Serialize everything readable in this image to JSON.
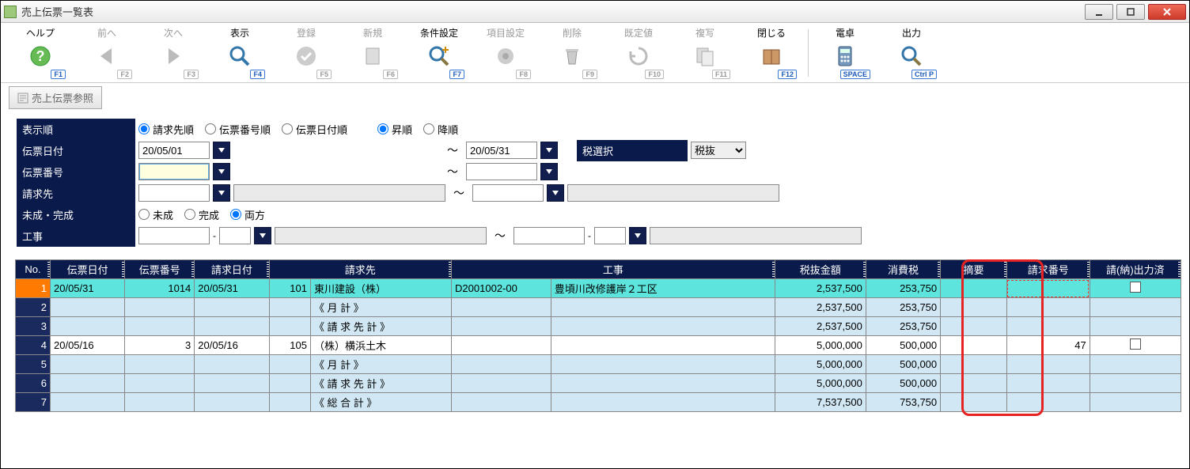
{
  "window": {
    "title": "売上伝票一覧表"
  },
  "toolbar": [
    {
      "label": "ヘルプ",
      "key": "F1",
      "icon": "help",
      "enabled": true
    },
    {
      "label": "前へ",
      "key": "F2",
      "icon": "prev",
      "enabled": false
    },
    {
      "label": "次へ",
      "key": "F3",
      "icon": "next",
      "enabled": false
    },
    {
      "label": "表示",
      "key": "F4",
      "icon": "search",
      "enabled": true
    },
    {
      "label": "登録",
      "key": "F5",
      "icon": "ok",
      "enabled": false
    },
    {
      "label": "新規",
      "key": "F6",
      "icon": "new",
      "enabled": false
    },
    {
      "label": "条件設定",
      "key": "F7",
      "icon": "cond",
      "enabled": true
    },
    {
      "label": "項目設定",
      "key": "F8",
      "icon": "cols",
      "enabled": false
    },
    {
      "label": "削除",
      "key": "F9",
      "icon": "trash",
      "enabled": false
    },
    {
      "label": "既定値",
      "key": "F10",
      "icon": "default",
      "enabled": false
    },
    {
      "label": "複写",
      "key": "F11",
      "icon": "copy",
      "enabled": false
    },
    {
      "label": "閉じる",
      "key": "F12",
      "icon": "close",
      "enabled": true
    },
    {
      "label": "電卓",
      "key": "SPACE",
      "icon": "calc",
      "enabled": true
    },
    {
      "label": "出力",
      "key": "Ctrl P",
      "icon": "print",
      "enabled": true
    }
  ],
  "subtoolbar": {
    "ref_label": "売上伝票参照"
  },
  "filters": {
    "order_label": "表示順",
    "order_options": [
      "請求先順",
      "伝票番号順",
      "伝票日付順"
    ],
    "order_selected": "請求先順",
    "direction_options": [
      "昇順",
      "降順"
    ],
    "direction_selected": "昇順",
    "date_label": "伝票日付",
    "date_from": "20/05/01",
    "date_to": "20/05/31",
    "tax_label": "税選択",
    "tax_value": "税抜",
    "slipno_label": "伝票番号",
    "slipno_from": "",
    "slipno_to": "",
    "billto_label": "請求先",
    "billto_code": "",
    "billto_name1": "",
    "billto_code2": "",
    "billto_name2": "",
    "status_label": "未成・完成",
    "status_options": [
      "未成",
      "完成",
      "両方"
    ],
    "status_selected": "両方",
    "project_label": "工事",
    "project_from": "",
    "project_from_sub": "",
    "project_from_name": "",
    "project_to": "",
    "project_to_sub": "",
    "project_to_name": ""
  },
  "grid": {
    "columns": [
      "No.",
      "伝票日付",
      "伝票番号",
      "請求日付",
      "請求先",
      "工事",
      "税抜金額",
      "消費税",
      "摘要",
      "請求番号",
      "請(納)出力済"
    ],
    "col_seikyusaki_code_hidden": true,
    "rows": [
      {
        "no": 1,
        "date": "20/05/31",
        "slip": "1014",
        "billdate": "20/05/31",
        "billcode": "101",
        "billto": "東川建設（株）",
        "project_code": "D2001002-00",
        "project": "豊頃川改修護岸２工区",
        "amount": "2,537,500",
        "tax": "253,750",
        "summary": "",
        "billno": "",
        "printed": false,
        "selected": true
      },
      {
        "no": 2,
        "billto": "《 月 計 》",
        "amount": "2,537,500",
        "tax": "253,750",
        "subtotal": true
      },
      {
        "no": 3,
        "billto": "《 請 求 先 計 》",
        "amount": "2,537,500",
        "tax": "253,750",
        "subtotal": true
      },
      {
        "no": 4,
        "date": "20/05/16",
        "slip": "3",
        "billdate": "20/05/16",
        "billcode": "105",
        "billto": "（株）横浜土木",
        "project_code": "",
        "project": "",
        "amount": "5,000,000",
        "tax": "500,000",
        "summary": "",
        "billno": "47",
        "printed": false
      },
      {
        "no": 5,
        "billto": "《 月 計 》",
        "amount": "5,000,000",
        "tax": "500,000",
        "subtotal": true
      },
      {
        "no": 6,
        "billto": "《 請 求 先 計 》",
        "amount": "5,000,000",
        "tax": "500,000",
        "subtotal": true
      },
      {
        "no": 7,
        "billto": "《 総 合 計 》",
        "amount": "7,537,500",
        "tax": "753,750",
        "subtotal": true
      }
    ]
  }
}
